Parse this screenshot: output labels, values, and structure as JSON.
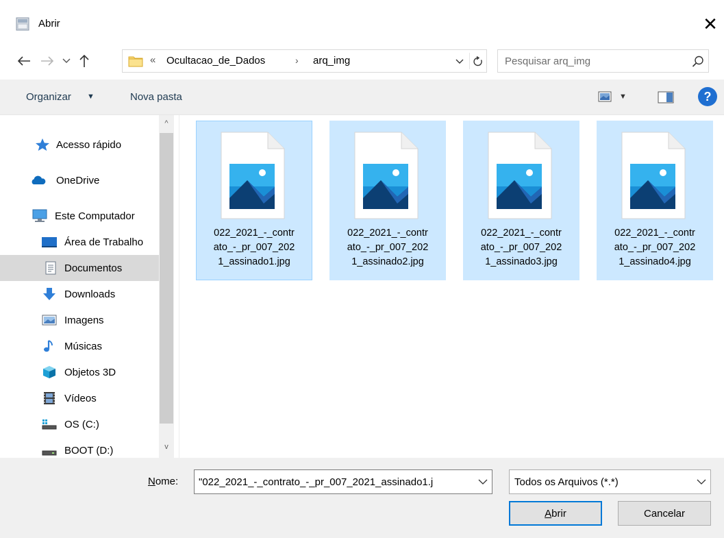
{
  "window": {
    "title": "Abrir",
    "icon": "dialog-app-icon",
    "close_label": "✕"
  },
  "navigation": {
    "back_icon": "arrow-left-icon",
    "forward_icon": "arrow-right-icon",
    "recent_icon": "chevron-down-icon",
    "up_icon": "arrow-up-icon",
    "address": {
      "overflow": "«",
      "segments": [
        "Ocultacao_de_Dados",
        "arq_img"
      ],
      "separator": "›"
    },
    "search_placeholder": "Pesquisar arq_img"
  },
  "toolbar": {
    "organize_label": "Organizar",
    "organize_caret": "▼",
    "new_folder_label": "Nova pasta",
    "view_caret": "▼",
    "help_label": "?"
  },
  "sidebar": {
    "items": [
      {
        "label": "Acesso rápido",
        "icon": "star-icon"
      },
      {
        "label": "OneDrive",
        "icon": "cloud-icon"
      },
      {
        "label": "Este Computador",
        "icon": "computer-icon"
      },
      {
        "label": "Área de Trabalho",
        "icon": "desktop-icon"
      },
      {
        "label": "Documentos",
        "icon": "documents-icon",
        "selected": true
      },
      {
        "label": "Downloads",
        "icon": "download-icon"
      },
      {
        "label": "Imagens",
        "icon": "pictures-icon"
      },
      {
        "label": "Músicas",
        "icon": "music-icon"
      },
      {
        "label": "Objetos 3D",
        "icon": "objects-3d-icon"
      },
      {
        "label": "Vídeos",
        "icon": "videos-icon"
      },
      {
        "label": "OS (C:)",
        "icon": "drive-c-icon"
      },
      {
        "label": "BOOT (D:)",
        "icon": "drive-d-icon"
      }
    ],
    "scroll_up": "^",
    "scroll_down": "v"
  },
  "files": [
    {
      "line1": "022_2021_-_contr",
      "line2": "ato_-_pr_007_202",
      "line3": "1_assinado1.jpg"
    },
    {
      "line1": "022_2021_-_contr",
      "line2": "ato_-_pr_007_202",
      "line3": "1_assinado2.jpg"
    },
    {
      "line1": "022_2021_-_contr",
      "line2": "ato_-_pr_007_202",
      "line3": "1_assinado3.jpg"
    },
    {
      "line1": "022_2021_-_contr",
      "line2": "ato_-_pr_007_202",
      "line3": "1_assinado4.jpg"
    }
  ],
  "footer": {
    "name_label_accel": "N",
    "name_label_rest": "ome:",
    "name_value": "\"022_2021_-_contrato_-_pr_007_2021_assinado1.j",
    "file_type": "Todos os Arquivos (*.*)",
    "open_accel": "A",
    "open_rest": "brir",
    "cancel_label": "Cancelar"
  },
  "colors": {
    "selection": "#cce8ff",
    "selection_border": "#99d1ff",
    "accent": "#0078d7",
    "toolbar_bg": "#f0f0f0"
  }
}
